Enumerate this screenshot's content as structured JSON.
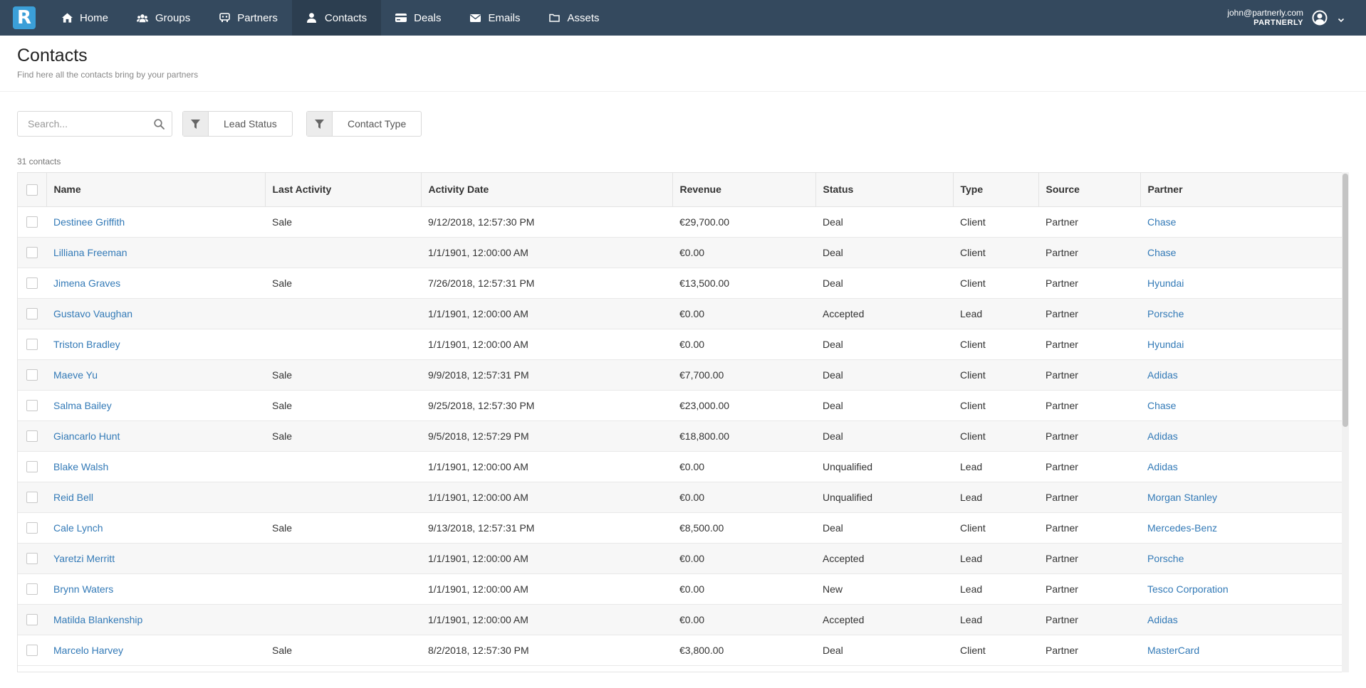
{
  "nav": {
    "logo": "R",
    "items": [
      {
        "label": "Home",
        "icon": "home-icon"
      },
      {
        "label": "Groups",
        "icon": "users-icon"
      },
      {
        "label": "Partners",
        "icon": "handshake-icon"
      },
      {
        "label": "Contacts",
        "icon": "user-icon",
        "active": true
      },
      {
        "label": "Deals",
        "icon": "card-icon"
      },
      {
        "label": "Emails",
        "icon": "envelope-icon"
      },
      {
        "label": "Assets",
        "icon": "folder-icon"
      }
    ],
    "user_email": "john@partnerly.com",
    "user_org": "PARTNERLY"
  },
  "page": {
    "title": "Contacts",
    "subtitle": "Find here all the contacts bring by your partners"
  },
  "filters": {
    "search_placeholder": "Search...",
    "lead_status_label": "Lead Status",
    "contact_type_label": "Contact Type"
  },
  "count_label": "31 contacts",
  "table": {
    "columns": [
      "Name",
      "Last Activity",
      "Activity Date",
      "Revenue",
      "Status",
      "Type",
      "Source",
      "Partner"
    ],
    "rows": [
      [
        "Destinee Griffith",
        "Sale",
        "9/12/2018, 12:57:30 PM",
        "€29,700.00",
        "Deal",
        "Client",
        "Partner",
        "Chase"
      ],
      [
        "Lilliana Freeman",
        "",
        "1/1/1901, 12:00:00 AM",
        "€0.00",
        "Deal",
        "Client",
        "Partner",
        "Chase"
      ],
      [
        "Jimena Graves",
        "Sale",
        "7/26/2018, 12:57:31 PM",
        "€13,500.00",
        "Deal",
        "Client",
        "Partner",
        "Hyundai"
      ],
      [
        "Gustavo Vaughan",
        "",
        "1/1/1901, 12:00:00 AM",
        "€0.00",
        "Accepted",
        "Lead",
        "Partner",
        "Porsche"
      ],
      [
        "Triston Bradley",
        "",
        "1/1/1901, 12:00:00 AM",
        "€0.00",
        "Deal",
        "Client",
        "Partner",
        "Hyundai"
      ],
      [
        "Maeve Yu",
        "Sale",
        "9/9/2018, 12:57:31 PM",
        "€7,700.00",
        "Deal",
        "Client",
        "Partner",
        "Adidas"
      ],
      [
        "Salma Bailey",
        "Sale",
        "9/25/2018, 12:57:30 PM",
        "€23,000.00",
        "Deal",
        "Client",
        "Partner",
        "Chase"
      ],
      [
        "Giancarlo Hunt",
        "Sale",
        "9/5/2018, 12:57:29 PM",
        "€18,800.00",
        "Deal",
        "Client",
        "Partner",
        "Adidas"
      ],
      [
        "Blake Walsh",
        "",
        "1/1/1901, 12:00:00 AM",
        "€0.00",
        "Unqualified",
        "Lead",
        "Partner",
        "Adidas"
      ],
      [
        "Reid Bell",
        "",
        "1/1/1901, 12:00:00 AM",
        "€0.00",
        "Unqualified",
        "Lead",
        "Partner",
        "Morgan Stanley"
      ],
      [
        "Cale Lynch",
        "Sale",
        "9/13/2018, 12:57:31 PM",
        "€8,500.00",
        "Deal",
        "Client",
        "Partner",
        "Mercedes-Benz"
      ],
      [
        "Yaretzi Merritt",
        "",
        "1/1/1901, 12:00:00 AM",
        "€0.00",
        "Accepted",
        "Lead",
        "Partner",
        "Porsche"
      ],
      [
        "Brynn Waters",
        "",
        "1/1/1901, 12:00:00 AM",
        "€0.00",
        "New",
        "Lead",
        "Partner",
        "Tesco Corporation"
      ],
      [
        "Matilda Blankenship",
        "",
        "1/1/1901, 12:00:00 AM",
        "€0.00",
        "Accepted",
        "Lead",
        "Partner",
        "Adidas"
      ],
      [
        "Marcelo Harvey",
        "Sale",
        "8/2/2018, 12:57:30 PM",
        "€3,800.00",
        "Deal",
        "Client",
        "Partner",
        "MasterCard"
      ]
    ]
  },
  "colors": {
    "nav_bg": "#34495e",
    "nav_active": "#2c3e50",
    "logo": "#3b9fd8",
    "link": "#337ab7"
  }
}
